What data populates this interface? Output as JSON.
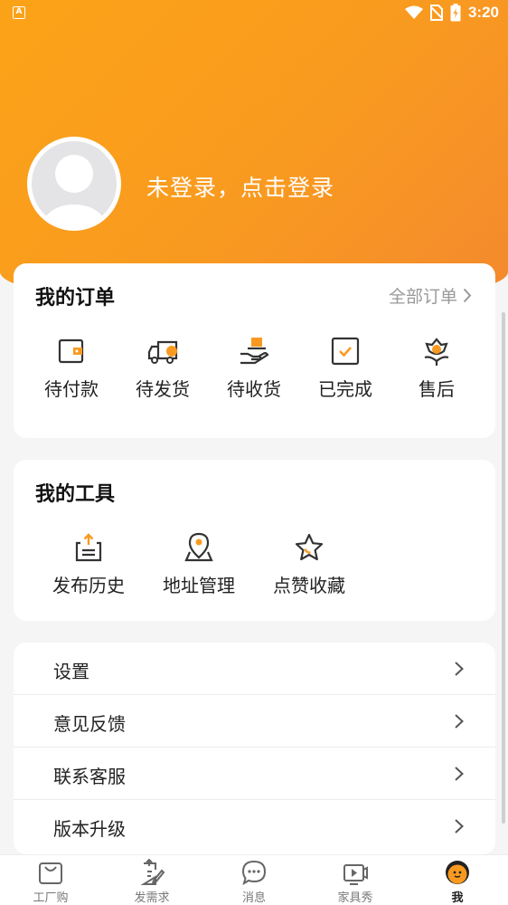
{
  "status_bar": {
    "time": "3:20",
    "app_icon_letter": "A"
  },
  "profile": {
    "login_text": "未登录，点击登录"
  },
  "orders": {
    "title": "我的订单",
    "all_link": "全部订单",
    "items": [
      {
        "label": "待付款",
        "icon": "wallet-icon"
      },
      {
        "label": "待发货",
        "icon": "truck-icon"
      },
      {
        "label": "待收货",
        "icon": "hand-package-icon"
      },
      {
        "label": "已完成",
        "icon": "checkbox-icon"
      },
      {
        "label": "售后",
        "icon": "flower-hand-icon"
      }
    ]
  },
  "tools": {
    "title": "我的工具",
    "items": [
      {
        "label": "发布历史",
        "icon": "upload-tray-icon"
      },
      {
        "label": "地址管理",
        "icon": "location-pin-icon"
      },
      {
        "label": "点赞收藏",
        "icon": "star-icon"
      }
    ]
  },
  "menu": {
    "items": [
      {
        "label": "设置"
      },
      {
        "label": "意见反馈"
      },
      {
        "label": "联系客服"
      },
      {
        "label": "版本升级"
      }
    ]
  },
  "tabbar": {
    "items": [
      {
        "label": "工厂购",
        "icon": "shopping-bag-icon"
      },
      {
        "label": "发需求",
        "icon": "edit-document-icon"
      },
      {
        "label": "消息",
        "icon": "chat-bubble-icon"
      },
      {
        "label": "家具秀",
        "icon": "video-play-icon"
      },
      {
        "label": "我",
        "icon": "profile-face-icon",
        "active": true
      }
    ]
  },
  "colors": {
    "accent": "#f99a20",
    "accent_dark": "#f4892e"
  }
}
